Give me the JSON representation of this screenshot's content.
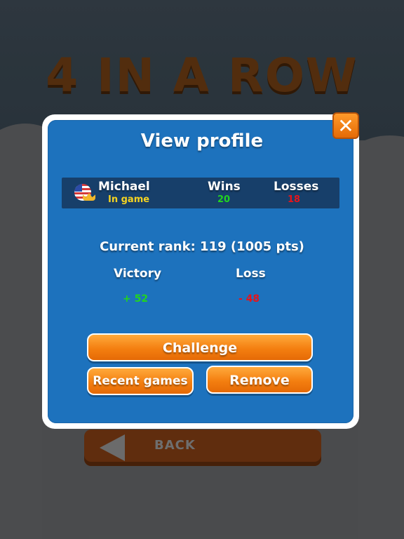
{
  "background": {
    "game_title": "4 IN A ROW",
    "back_label": "BACK"
  },
  "dialog": {
    "title": "View profile",
    "close_icon": "close-icon",
    "player": {
      "name": "Michael",
      "status": "In game",
      "flag_icon": "us-flag-icon",
      "badge_icon": "crown-icon",
      "wins_label": "Wins",
      "wins_value": "20",
      "losses_label": "Losses",
      "losses_value": "18"
    },
    "rank_text": "Current rank: 119 (1005 pts)",
    "victory_label": "Victory",
    "victory_value": "+ 52",
    "loss_label": "Loss",
    "loss_value": "- 48",
    "challenge_label": "Challenge",
    "recent_games_label": "Recent games",
    "remove_label": "Remove"
  },
  "colors": {
    "panel_blue": "#1d72bd",
    "row_dark": "#173f6a",
    "orange": "#f47f10",
    "status_yellow": "#f5d321",
    "win_green": "#22d41f",
    "loss_red": "#e6151a"
  }
}
